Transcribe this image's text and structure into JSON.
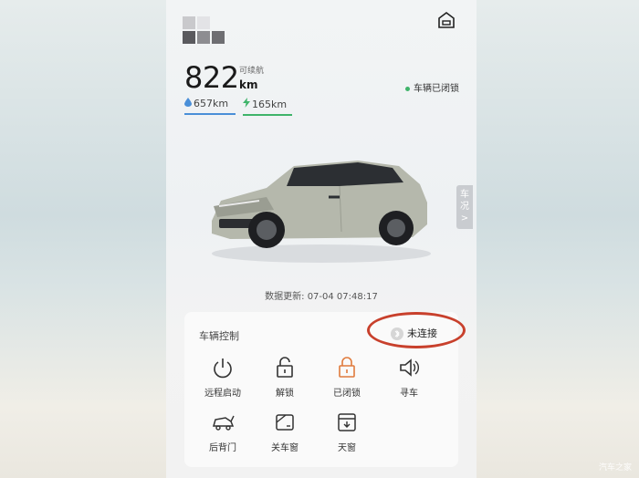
{
  "range": {
    "total_value": "822",
    "total_label": "可续航",
    "total_unit": "km",
    "fuel_value": "657km",
    "electric_value": "165km"
  },
  "status": {
    "lock_text": "车辆已闭锁"
  },
  "side_tab": {
    "label_line1": "车",
    "label_line2": "况",
    "chevron": ">"
  },
  "update": {
    "text": "数据更新: 07-04 07:48:17"
  },
  "control_panel": {
    "title": "车辆控制",
    "bluetooth_status": "未连接",
    "controls": [
      {
        "label": "远程启动",
        "icon": "power-icon"
      },
      {
        "label": "解锁",
        "icon": "unlock-icon"
      },
      {
        "label": "已闭锁",
        "icon": "lock-icon"
      },
      {
        "label": "寻车",
        "icon": "horn-icon"
      },
      {
        "label": "后背门",
        "icon": "tailgate-icon"
      },
      {
        "label": "关车窗",
        "icon": "window-icon"
      },
      {
        "label": "天窗",
        "icon": "sunroof-icon"
      }
    ]
  },
  "colors": {
    "fuel_accent": "#4a8fd8",
    "electric_accent": "#3fb46a",
    "lock_accent": "#e07b3c",
    "annotation_ring": "#c8402c"
  },
  "watermark": "汽车之家"
}
